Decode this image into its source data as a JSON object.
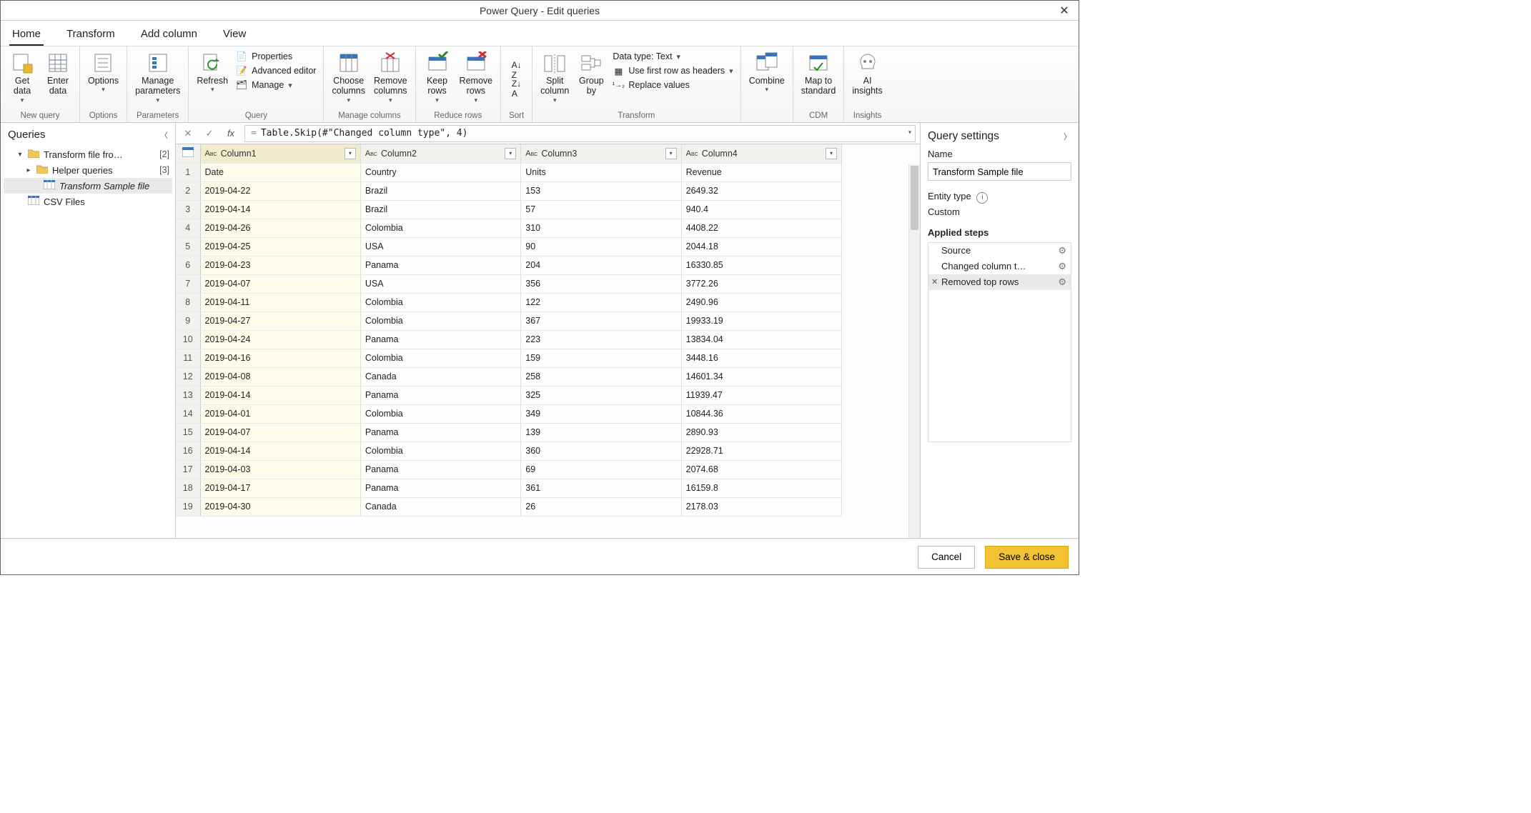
{
  "window": {
    "title": "Power Query - Edit queries"
  },
  "tabs": [
    "Home",
    "Transform",
    "Add column",
    "View"
  ],
  "active_tab_index": 0,
  "ribbon": {
    "groups": [
      {
        "label": "New query",
        "buttons": [
          {
            "label": "Get\ndata",
            "drop": true
          },
          {
            "label": "Enter\ndata"
          }
        ]
      },
      {
        "label": "Options",
        "buttons": [
          {
            "label": "Options",
            "drop": true
          }
        ]
      },
      {
        "label": "Parameters",
        "buttons": [
          {
            "label": "Manage\nparameters",
            "drop": true
          }
        ]
      },
      {
        "label": "Query",
        "big": [
          {
            "label": "Refresh",
            "drop": true
          }
        ],
        "small": [
          {
            "label": "Properties"
          },
          {
            "label": "Advanced editor"
          },
          {
            "label": "Manage",
            "drop": true
          }
        ]
      },
      {
        "label": "Manage columns",
        "buttons": [
          {
            "label": "Choose\ncolumns",
            "drop": true
          },
          {
            "label": "Remove\ncolumns",
            "drop": true
          }
        ]
      },
      {
        "label": "Reduce rows",
        "buttons": [
          {
            "label": "Keep\nrows",
            "drop": true
          },
          {
            "label": "Remove\nrows",
            "drop": true
          }
        ]
      },
      {
        "label": "Sort",
        "buttons": [
          {
            "label": ""
          }
        ]
      },
      {
        "label": "Transform",
        "big": [
          {
            "label": "Split\ncolumn",
            "drop": true
          },
          {
            "label": "Group\nby"
          }
        ],
        "small": [
          {
            "label": "Data type: Text",
            "drop": true
          },
          {
            "label": "Use first row as headers",
            "drop": true
          },
          {
            "label": "Replace values"
          }
        ]
      },
      {
        "label": "",
        "buttons": [
          {
            "label": "Combine",
            "drop": true
          }
        ]
      },
      {
        "label": "CDM",
        "buttons": [
          {
            "label": "Map to\nstandard"
          }
        ]
      },
      {
        "label": "Insights",
        "buttons": [
          {
            "label": "AI\ninsights"
          }
        ]
      }
    ]
  },
  "queries_pane": {
    "title": "Queries",
    "items": [
      {
        "label": "Transform file fro…",
        "type": "folder",
        "count": "[2]",
        "expanded": true,
        "depth": 0
      },
      {
        "label": "Helper queries",
        "type": "folder",
        "count": "[3]",
        "expanded": false,
        "depth": 1
      },
      {
        "label": "Transform Sample file",
        "type": "query",
        "selected": true,
        "italic": true,
        "depth": 2
      },
      {
        "label": "CSV Files",
        "type": "query",
        "depth": 0
      }
    ]
  },
  "formula_bar": {
    "formula": "Table.Skip(#\"Changed column type\", 4)"
  },
  "grid": {
    "columns": [
      "Column1",
      "Column2",
      "Column3",
      "Column4"
    ],
    "selected_column_index": 0,
    "rows": [
      [
        "Date",
        "Country",
        "Units",
        "Revenue"
      ],
      [
        "2019-04-22",
        "Brazil",
        "153",
        "2649.32"
      ],
      [
        "2019-04-14",
        "Brazil",
        "57",
        "940.4"
      ],
      [
        "2019-04-26",
        "Colombia",
        "310",
        "4408.22"
      ],
      [
        "2019-04-25",
        "USA",
        "90",
        "2044.18"
      ],
      [
        "2019-04-23",
        "Panama",
        "204",
        "16330.85"
      ],
      [
        "2019-04-07",
        "USA",
        "356",
        "3772.26"
      ],
      [
        "2019-04-11",
        "Colombia",
        "122",
        "2490.96"
      ],
      [
        "2019-04-27",
        "Colombia",
        "367",
        "19933.19"
      ],
      [
        "2019-04-24",
        "Panama",
        "223",
        "13834.04"
      ],
      [
        "2019-04-16",
        "Colombia",
        "159",
        "3448.16"
      ],
      [
        "2019-04-08",
        "Canada",
        "258",
        "14601.34"
      ],
      [
        "2019-04-14",
        "Panama",
        "325",
        "11939.47"
      ],
      [
        "2019-04-01",
        "Colombia",
        "349",
        "10844.36"
      ],
      [
        "2019-04-07",
        "Panama",
        "139",
        "2890.93"
      ],
      [
        "2019-04-14",
        "Colombia",
        "360",
        "22928.71"
      ],
      [
        "2019-04-03",
        "Panama",
        "69",
        "2074.68"
      ],
      [
        "2019-04-17",
        "Panama",
        "361",
        "16159.8"
      ],
      [
        "2019-04-30",
        "Canada",
        "26",
        "2178.03"
      ]
    ]
  },
  "settings": {
    "title": "Query settings",
    "name_label": "Name",
    "name_value": "Transform Sample file",
    "entity_label": "Entity type",
    "entity_value": "Custom",
    "steps_label": "Applied steps",
    "steps": [
      {
        "label": "Source",
        "gear": true
      },
      {
        "label": "Changed column t…",
        "gear": true
      },
      {
        "label": "Removed top rows",
        "gear": true,
        "selected": true,
        "deletable": true
      }
    ]
  },
  "footer": {
    "cancel": "Cancel",
    "save": "Save & close"
  }
}
